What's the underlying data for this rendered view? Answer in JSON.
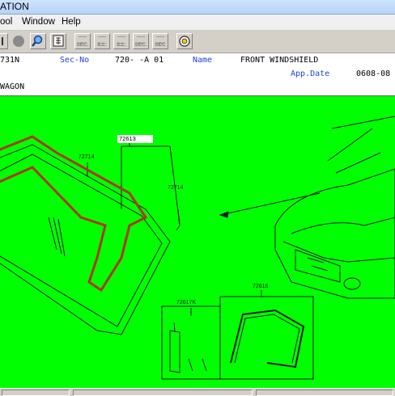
{
  "window": {
    "title": "ATION"
  },
  "menu": {
    "tool": "ool",
    "window": "Window",
    "help": "Help"
  },
  "toolbar": {
    "buttons": [
      {
        "name": "back-icon"
      },
      {
        "name": "record-icon"
      },
      {
        "name": "search-icon"
      },
      {
        "name": "page-icon"
      }
    ],
    "section_buttons": [
      {
        "label": "SEC."
      },
      {
        "label": "ILL."
      },
      {
        "label": "ILL."
      },
      {
        "label": "SEC."
      },
      {
        "label": "SEC"
      }
    ],
    "help_icon": "help-icon"
  },
  "info": {
    "code": "731N",
    "sec_no_label": "Sec-No",
    "sec_no_value": "720-  -A 01",
    "name_label": "Name",
    "name_value": "FRONT WINDSHIELD",
    "app_date_label": "App.Date",
    "app_date_value": "0608-08",
    "model": "WAGON"
  },
  "diagram": {
    "background": "#00ff00",
    "highlight_color": "#a83a1e",
    "callouts": {
      "windshield": "72613",
      "clip_left": "72714",
      "clip_right": "72714",
      "kit": "72617K",
      "molding": "72616"
    }
  }
}
